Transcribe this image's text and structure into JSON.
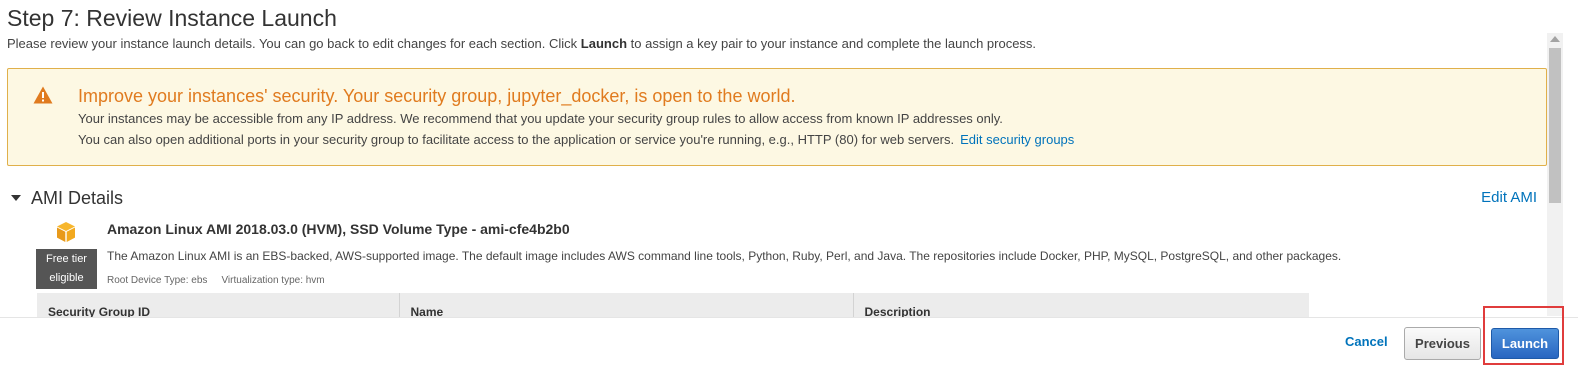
{
  "page": {
    "title": "Step 7: Review Instance Launch",
    "intro_before": "Please review your instance launch details. You can go back to edit changes for each section. Click ",
    "intro_bold": "Launch",
    "intro_after": " to assign a key pair to your instance and complete the launch process."
  },
  "warning": {
    "icon": "warning-triangle-icon",
    "title": "Improve your instances' security. Your security group, jupyter_docker, is open to the world.",
    "line1": "Your instances may be accessible from any IP address. We recommend that you update your security group rules to allow access from known IP addresses only.",
    "line2": "You can also open additional ports in your security group to facilitate access to the application or service you're running, e.g., HTTP (80) for web servers.",
    "link": "Edit security groups",
    "colors": {
      "background": "#fdf8e3",
      "border": "#e0b04a",
      "title": "#e07b1f"
    }
  },
  "ami_section": {
    "title": "AMI Details",
    "edit_label": "Edit AMI",
    "icon": "amazon-cube-icon",
    "name": "Amazon Linux AMI 2018.03.0 (HVM), SSD Volume Type - ami-cfe4b2b0",
    "description": "The Amazon Linux AMI is an EBS-backed, AWS-supported image. The default image includes AWS command line tools, Python, Ruby, Perl, and Java. The repositories include Docker, PHP, MySQL, PostgreSQL, and other packages.",
    "root_device": "Root Device Type: ebs",
    "virtualization": "Virtualization type: hvm",
    "free_tier_line1": "Free tier",
    "free_tier_line2": "eligible"
  },
  "security_table": {
    "columns": [
      "Security Group ID",
      "Name",
      "Description"
    ]
  },
  "footer": {
    "cancel": "Cancel",
    "previous": "Previous",
    "launch": "Launch",
    "colors": {
      "primary": "#2866c1",
      "link": "#0073bb",
      "highlight": "#e03c3c"
    }
  }
}
